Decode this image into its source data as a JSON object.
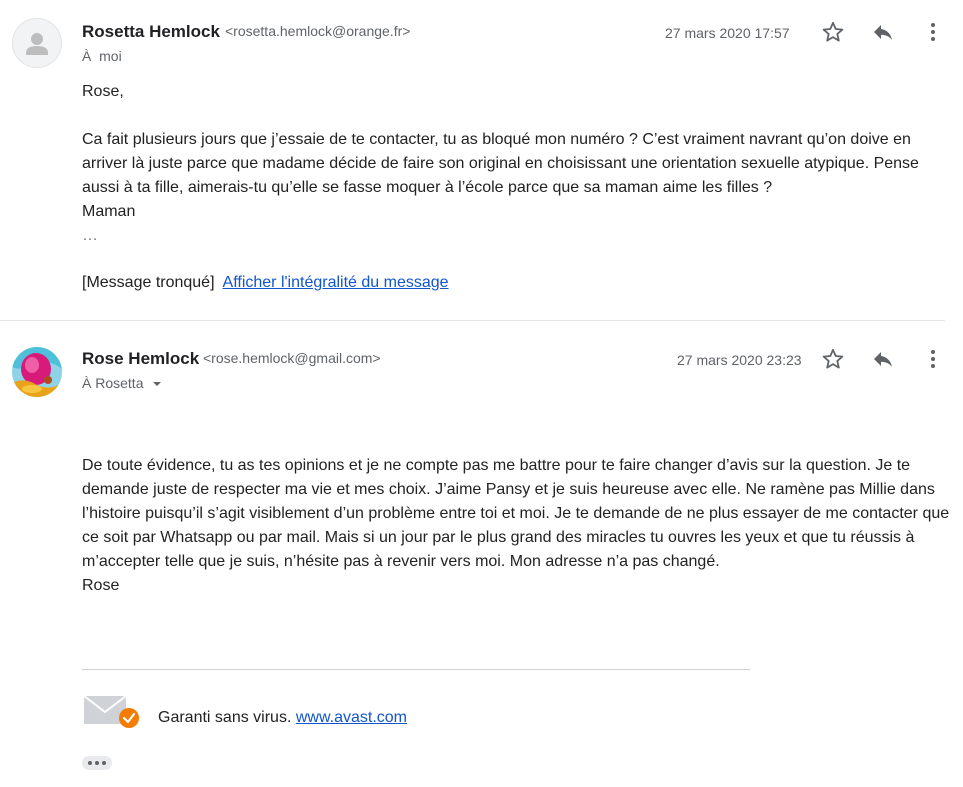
{
  "messages": [
    {
      "sender_name": "Rosetta Hemlock",
      "sender_email": "<rosetta.hemlock@orange.fr>",
      "to_prefix": "À",
      "to_value": "moi",
      "date": "27 mars 2020 17:57",
      "body": [
        "Rose,",
        "Ca fait plusieurs jours que j’essaie de te contacter, tu as bloqué mon numéro ? C’est vraiment navrant qu’on doive en arriver là juste parce que madame décide de faire son original en choisissant une orientation sexuelle atypique. Pense aussi à ta fille, aimerais-tu qu’elle se fasse moquer à l’école parce que sa maman aime les filles ?",
        "Maman",
        "…"
      ],
      "truncated_label": "[Message tronqué]",
      "show_full_link": "Afficher l'intégralité du message"
    },
    {
      "sender_name": "Rose Hemlock",
      "sender_email": "<rose.hemlock@gmail.com>",
      "to_value": "À Rosetta",
      "date": "27 mars 2020 23:23",
      "body": [
        "De toute évidence, tu as tes opinions et je ne compte pas me battre pour te faire changer d’avis sur la question. Je te demande juste de respecter ma vie et mes choix. J’aime Pansy et je suis heureuse avec elle. Ne ramène pas Millie dans l’histoire puisqu’il s’agit visiblement d’un problème entre toi et moi. Je te demande de ne plus essayer de me contacter que ce soit par Whatsapp ou par mail. Mais si un jour par le plus grand des miracles tu ouvres les yeux et que tu réussis à m’accepter telle que je suis, n’hésite pas à revenir vers moi. Mon adresse n’a pas changé.",
        "Rose"
      ],
      "signature_text": "Garanti sans virus.",
      "signature_link": "www.avast.com"
    }
  ],
  "icons": {
    "star": "star-icon",
    "reply": "reply-icon",
    "more": "more-vert-icon",
    "avatar_generic": "person-icon",
    "dropdown": "caret-down-icon",
    "mail": "mail-icon",
    "check": "check-badge-icon"
  },
  "colors": {
    "link": "#1155cc",
    "icon": "#5f6368",
    "badge": "#f57c00"
  }
}
